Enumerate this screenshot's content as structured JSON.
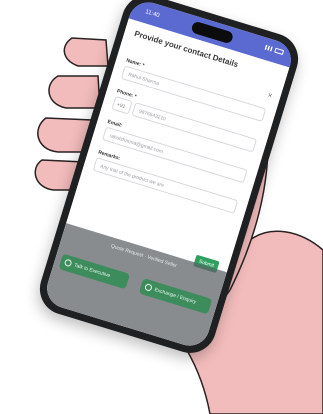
{
  "status": {
    "time": "11:40"
  },
  "form": {
    "title": "Provide your contact Details",
    "close": "×",
    "name": {
      "label": "Name: *",
      "value": "Rahul Sharma"
    },
    "phone": {
      "label": "Phone: *",
      "code": "+91",
      "value": "9876543210"
    },
    "email": {
      "label": "Email:",
      "value": "rahulsharma@gmail.com"
    },
    "remarks": {
      "label": "Remarks:",
      "placeholder": "Any trial of the product we are"
    },
    "submit_label": "Submit"
  },
  "footer": {
    "text": "Quote Request · Verified Seller",
    "left_button": "Talk to Executive",
    "right_button": "Exchange / Enquiry"
  },
  "colors": {
    "header": "#5b6ad0",
    "accent": "#2fa060",
    "hand": "#f3bcbc",
    "outline": "#2a2223"
  }
}
